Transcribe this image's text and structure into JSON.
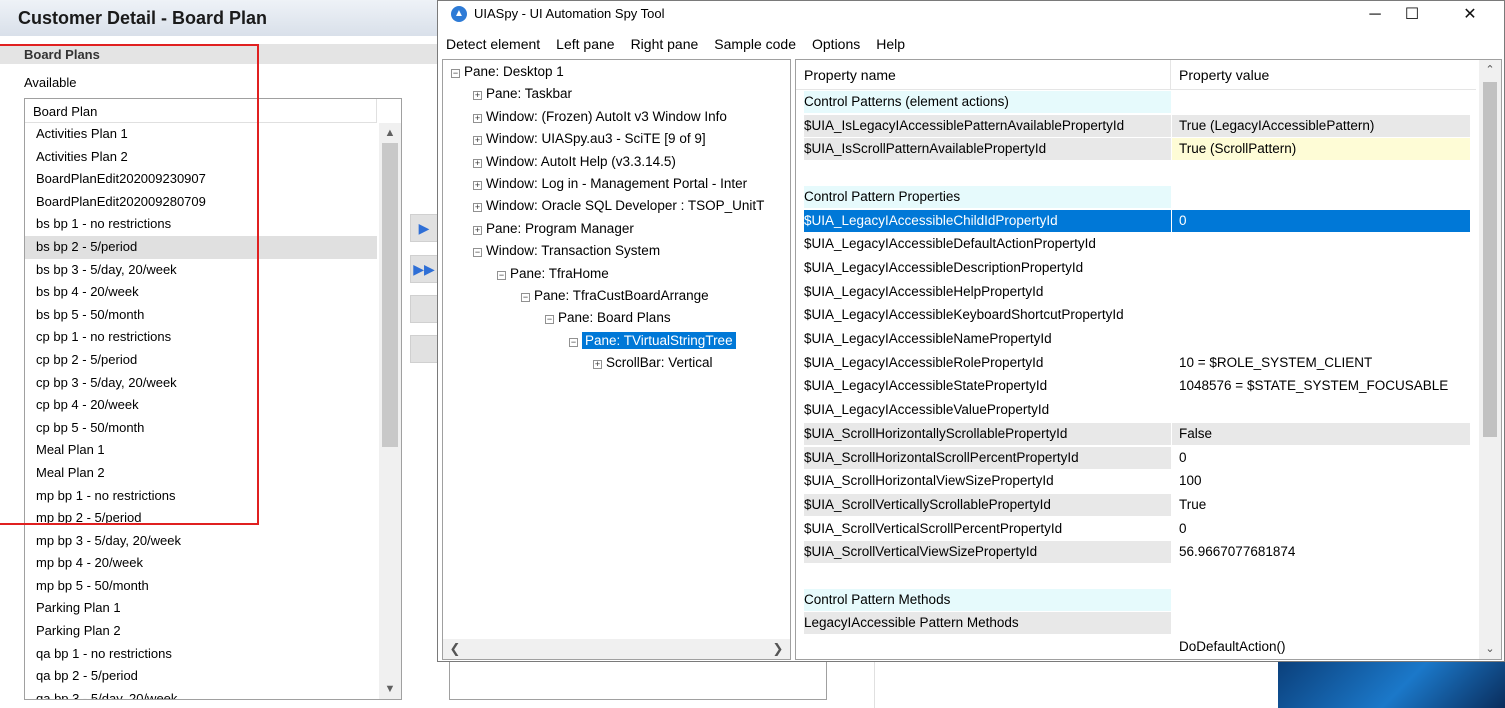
{
  "background_app": {
    "title": "Customer Detail - Board Plan",
    "section_header": "Board Plans",
    "available_label": "Available",
    "list_column": "Board Plan",
    "items": [
      "Activities Plan 1",
      "Activities Plan 2",
      "BoardPlanEdit202009230907",
      "BoardPlanEdit202009280709",
      "bs bp 1 - no restrictions",
      "bs bp 2 - 5/period",
      "bs bp 3 - 5/day, 20/week",
      "bs bp 4 - 20/week",
      "bs bp 5 - 50/month",
      "cp bp 1 - no restrictions",
      "cp bp 2 - 5/period",
      "cp bp 3 - 5/day, 20/week",
      "cp bp 4 - 20/week",
      "cp bp 5 - 50/month",
      "Meal Plan 1",
      "Meal Plan 2",
      "mp bp 1 - no restrictions",
      "mp bp 2 - 5/period",
      "mp bp 3 - 5/day, 20/week",
      "mp bp 4 - 20/week",
      "mp bp 5 - 50/month",
      "Parking Plan 1",
      "Parking Plan 2",
      "qa bp 1 - no restrictions",
      "qa bp 2 - 5/period",
      "qa bp 3 - 5/day, 20/week"
    ],
    "selected_item": "bs bp 2 - 5/period"
  },
  "spy": {
    "title": "UIASpy - UI Automation Spy Tool",
    "controls": {
      "minimize": "─",
      "maximize": "☐",
      "close": "✕"
    },
    "menu": [
      "Detect element",
      "Left pane",
      "Right pane",
      "Sample code",
      "Options",
      "Help"
    ],
    "tree": [
      {
        "label": "Pane: Desktop 1",
        "box": "−"
      },
      {
        "label": "Pane: Taskbar",
        "box": "+"
      },
      {
        "label": "Window: (Frozen) AutoIt v3 Window Info",
        "box": "+"
      },
      {
        "label": "Window: UIASpy.au3 - SciTE [9 of 9]",
        "box": "+"
      },
      {
        "label": "Window: AutoIt Help (v3.3.14.5)",
        "box": "+"
      },
      {
        "label": "Window: Log in - Management Portal - Inter",
        "box": "+"
      },
      {
        "label": "Window: Oracle SQL Developer : TSOP_UnitT",
        "box": "+"
      },
      {
        "label": "Pane: Program Manager",
        "box": "+"
      },
      {
        "label": "Window: Transaction System",
        "box": "−"
      },
      {
        "label": "Pane: TfraHome",
        "box": "−"
      },
      {
        "label": "Pane: TfraCustBoardArrange",
        "box": "−"
      },
      {
        "label": "Pane: Board Plans",
        "box": "−"
      },
      {
        "label": "Pane: TVirtualStringTree",
        "box": "−"
      },
      {
        "label": "ScrollBar: Vertical",
        "box": "+"
      }
    ],
    "properties": {
      "header_name": "Property name",
      "header_value": "Property value",
      "rows": [
        {
          "name": "Control Patterns (element actions)",
          "value": ""
        },
        {
          "name": "$UIA_IsLegacyIAccessiblePatternAvailablePropertyId",
          "value": "True (LegacyIAccessiblePattern)"
        },
        {
          "name": "$UIA_IsScrollPatternAvailablePropertyId",
          "value": "True (ScrollPattern)"
        },
        {
          "name": "",
          "value": ""
        },
        {
          "name": "Control Pattern Properties",
          "value": ""
        },
        {
          "name": "$UIA_LegacyIAccessibleChildIdPropertyId",
          "value": "0"
        },
        {
          "name": "$UIA_LegacyIAccessibleDefaultActionPropertyId",
          "value": ""
        },
        {
          "name": "$UIA_LegacyIAccessibleDescriptionPropertyId",
          "value": ""
        },
        {
          "name": "$UIA_LegacyIAccessibleHelpPropertyId",
          "value": ""
        },
        {
          "name": "$UIA_LegacyIAccessibleKeyboardShortcutPropertyId",
          "value": ""
        },
        {
          "name": "$UIA_LegacyIAccessibleNamePropertyId",
          "value": ""
        },
        {
          "name": "$UIA_LegacyIAccessibleRolePropertyId",
          "value": "10 = $ROLE_SYSTEM_CLIENT"
        },
        {
          "name": "$UIA_LegacyIAccessibleStatePropertyId",
          "value": "1048576 = $STATE_SYSTEM_FOCUSABLE"
        },
        {
          "name": "$UIA_LegacyIAccessibleValuePropertyId",
          "value": ""
        },
        {
          "name": "$UIA_ScrollHorizontallyScrollablePropertyId",
          "value": "False"
        },
        {
          "name": "$UIA_ScrollHorizontalScrollPercentPropertyId",
          "value": "0"
        },
        {
          "name": "$UIA_ScrollHorizontalViewSizePropertyId",
          "value": "100"
        },
        {
          "name": "$UIA_ScrollVerticallyScrollablePropertyId",
          "value": "True"
        },
        {
          "name": "$UIA_ScrollVerticalScrollPercentPropertyId",
          "value": "0"
        },
        {
          "name": "$UIA_ScrollVerticalViewSizePropertyId",
          "value": "56.9667077681874"
        },
        {
          "name": "",
          "value": ""
        },
        {
          "name": "Control Pattern Methods",
          "value": ""
        },
        {
          "name": "LegacyIAccessible Pattern Methods",
          "value": ""
        },
        {
          "name": "",
          "value": "DoDefaultAction()"
        }
      ]
    }
  },
  "colors": {
    "selection": "#0078d7",
    "group_header": "#e6fafc",
    "highlight_value": "#fefcd6",
    "annotation_box": "#e02020"
  }
}
